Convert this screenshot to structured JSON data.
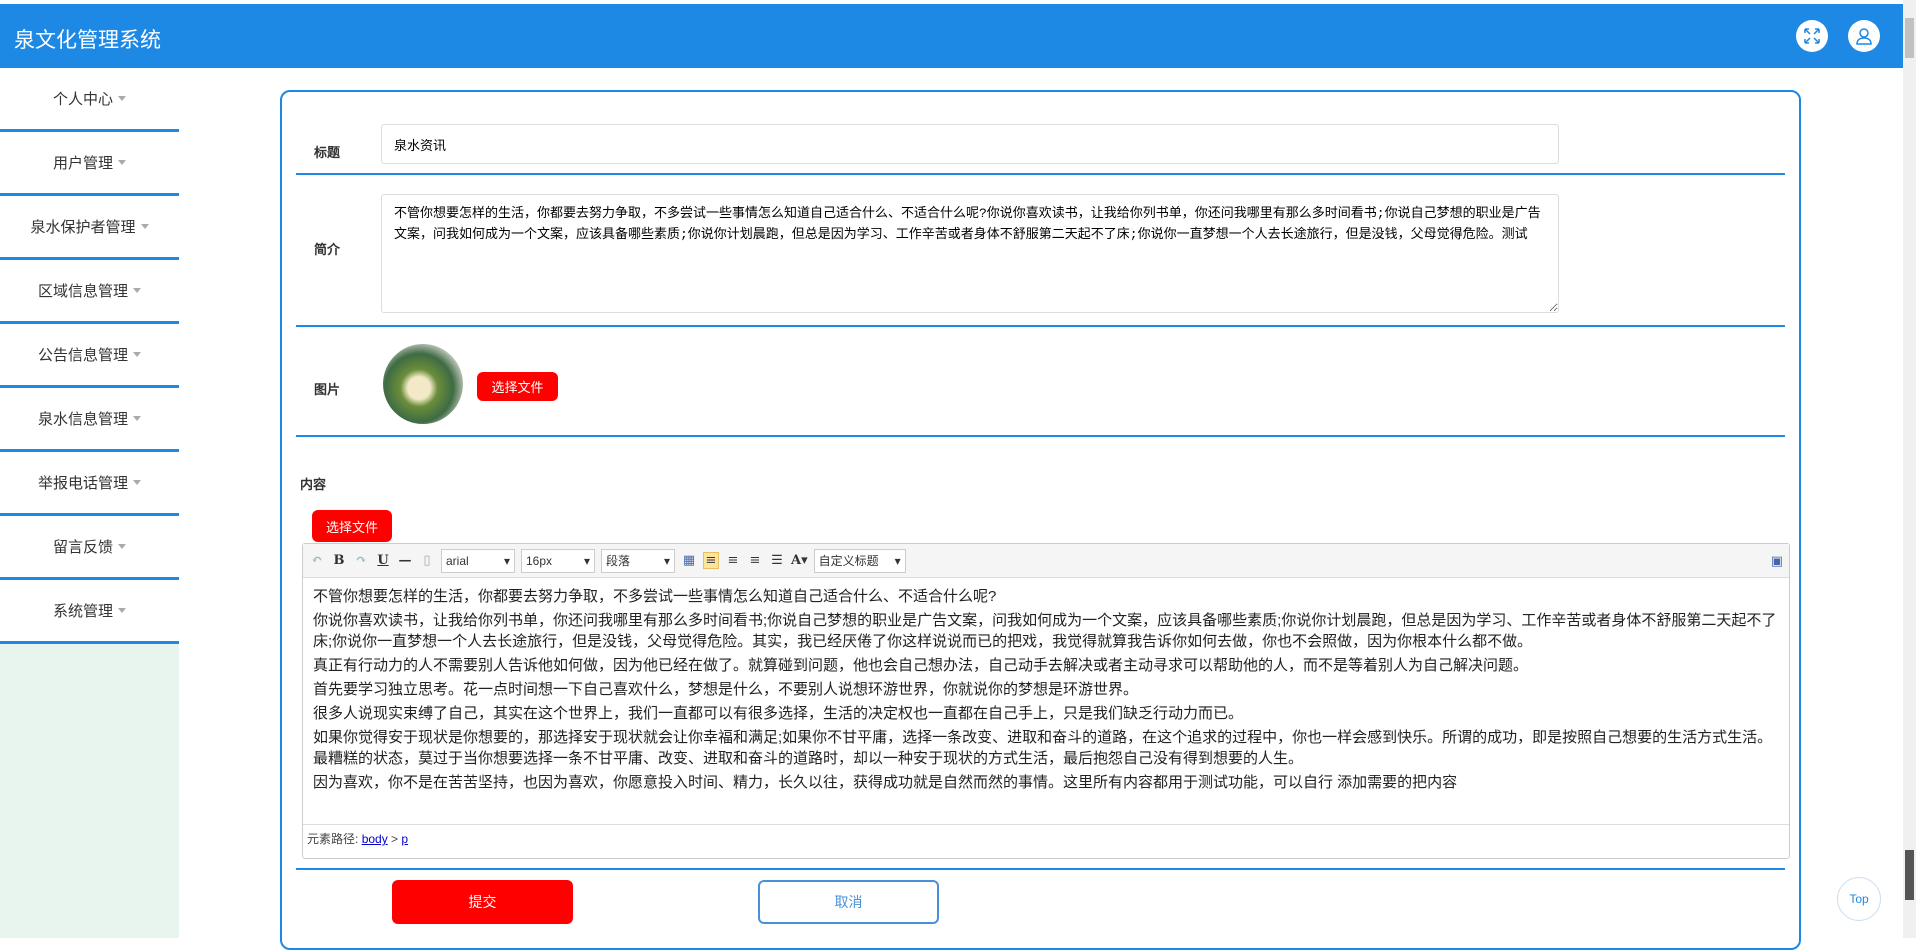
{
  "app": {
    "title": "泉文化管理系统"
  },
  "header": {
    "icons": [
      "fullscreen-icon",
      "user-icon"
    ]
  },
  "sidebar": {
    "items": [
      {
        "label": "个人中心"
      },
      {
        "label": "用户管理"
      },
      {
        "label": "泉水保护者管理"
      },
      {
        "label": "区域信息管理"
      },
      {
        "label": "公告信息管理"
      },
      {
        "label": "泉水信息管理"
      },
      {
        "label": "举报电话管理"
      },
      {
        "label": "留言反馈"
      },
      {
        "label": "系统管理"
      }
    ]
  },
  "form": {
    "title_label": "标题",
    "title_value": "泉水资讯",
    "intro_label": "简介",
    "intro_value": "不管你想要怎样的生活，你都要去努力争取，不多尝试一些事情怎么知道自己适合什么、不适合什么呢?你说你喜欢读书，让我给你列书单，你还问我哪里有那么多时间看书;你说自己梦想的职业是广告文案，问我如何成为一个文案，应该具备哪些素质;你说你计划晨跑，但总是因为学习、工作辛苦或者身体不舒服第二天起不了床;你说你一直梦想一个人去长途旅行，但是没钱，父母觉得危险。测试",
    "image_label": "图片",
    "choose_file": "选择文件",
    "content_label": "内容",
    "content_choose_file": "选择文件",
    "submit": "提交",
    "cancel": "取消"
  },
  "editor": {
    "font": "arial",
    "size": "16px",
    "paragraph": "段落",
    "custom_title": "自定义标题",
    "paragraphs": [
      "不管你想要怎样的生活，你都要去努力争取，不多尝试一些事情怎么知道自己适合什么、不适合什么呢?",
      "你说你喜欢读书，让我给你列书单，你还问我哪里有那么多时间看书;你说自己梦想的职业是广告文案，问我如何成为一个文案，应该具备哪些素质;你说你计划晨跑，但总是因为学习、工作辛苦或者身体不舒服第二天起不了床;你说你一直梦想一个人去长途旅行，但是没钱，父母觉得危险。其实，我已经厌倦了你这样说说而已的把戏，我觉得就算我告诉你如何去做，你也不会照做，因为你根本什么都不做。",
      "真正有行动力的人不需要别人告诉他如何做，因为他已经在做了。就算碰到问题，他也会自己想办法，自己动手去解决或者主动寻求可以帮助他的人，而不是等着别人为自己解决问题。",
      "首先要学习独立思考。花一点时间想一下自己喜欢什么，梦想是什么，不要别人说想环游世界，你就说你的梦想是环游世界。",
      "很多人说现实束缚了自己，其实在这个世界上，我们一直都可以有很多选择，生活的决定权也一直都在自己手上，只是我们缺乏行动力而已。",
      "如果你觉得安于现状是你想要的，那选择安于现状就会让你幸福和满足;如果你不甘平庸，选择一条改变、进取和奋斗的道路，在这个追求的过程中，你也一样会感到快乐。所谓的成功，即是按照自己想要的生活方式生活。最糟糕的状态，莫过于当你想要选择一条不甘平庸、改变、进取和奋斗的道路时，却以一种安于现状的方式生活，最后抱怨自己没有得到想要的人生。",
      "因为喜欢，你不是在苦苦坚持，也因为喜欢，你愿意投入时间、精力，长久以往，获得成功就是自然而然的事情。这里所有内容都用于测试功能，可以自行 添加需要的把内容"
    ],
    "path_label": "元素路径:",
    "path_body": "body",
    "path_sep": " > ",
    "path_p": "p"
  },
  "top_button": "Top",
  "colors": {
    "primary": "#1e88e5",
    "danger": "#ff0000"
  }
}
